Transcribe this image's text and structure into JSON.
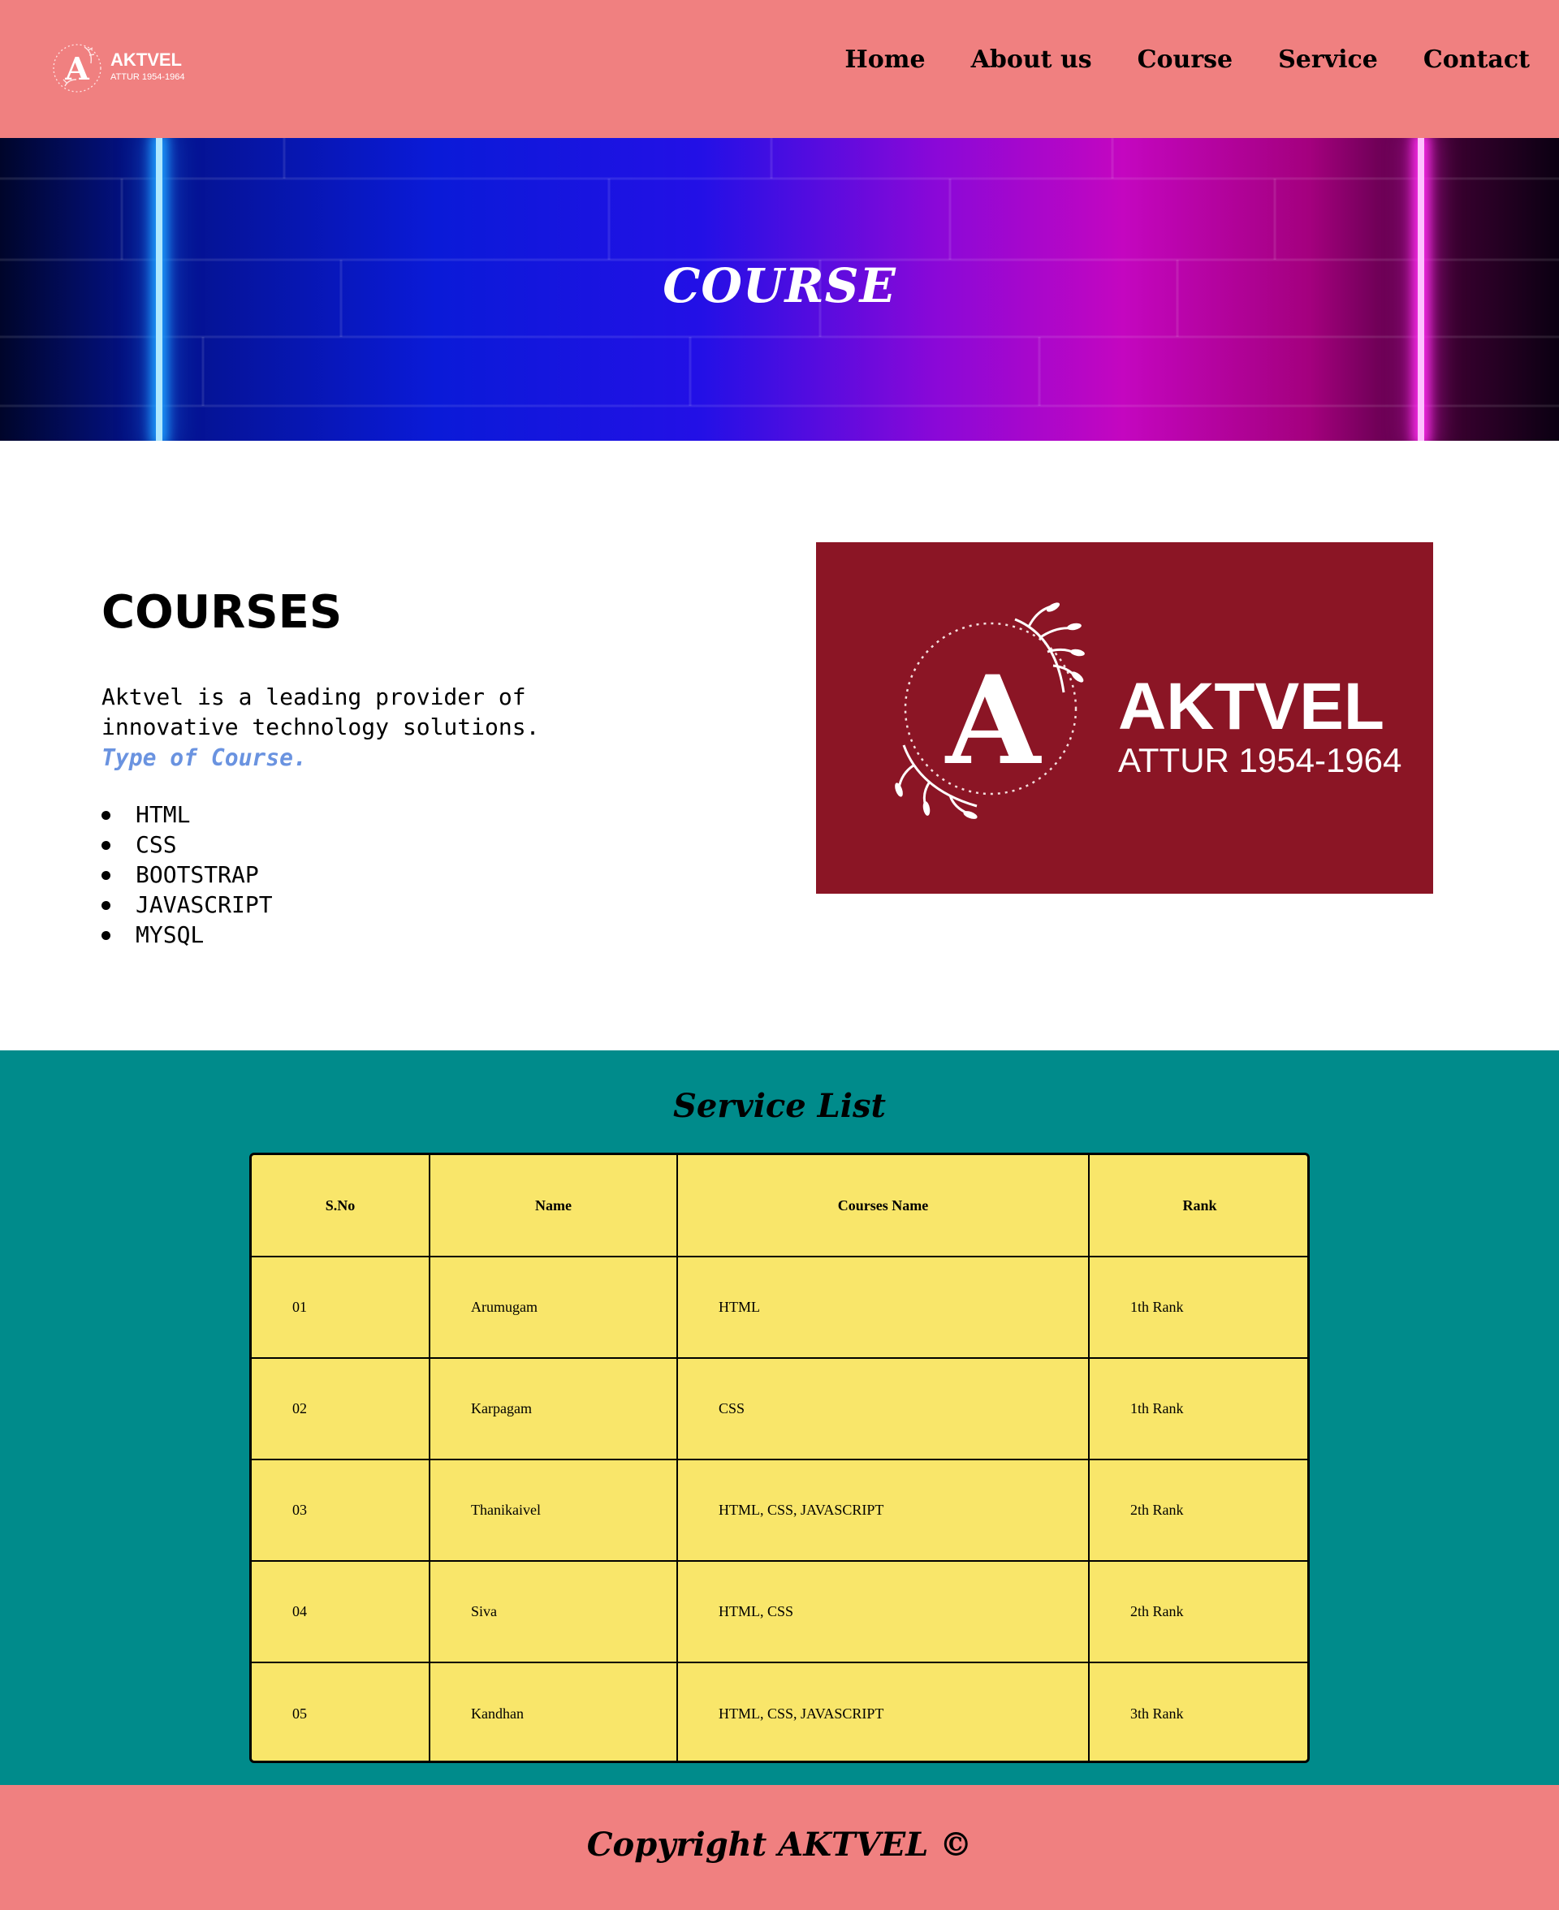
{
  "brand": {
    "name": "AKTVEL",
    "subtitle": "ATTUR 1954-1964",
    "initial": "A"
  },
  "nav": {
    "items": [
      {
        "label": "Home"
      },
      {
        "label": "About us"
      },
      {
        "label": "Course"
      },
      {
        "label": "Service"
      },
      {
        "label": "Contact"
      }
    ]
  },
  "hero": {
    "title": "COURSE"
  },
  "courses": {
    "heading": "COURSES",
    "description": "Aktvel is a leading provider of innovative technology solutions.",
    "type_label": "Type of Course.",
    "items": [
      "HTML",
      "CSS",
      "BOOTSTRAP",
      "JAVASCRIPT",
      "MYSQL"
    ]
  },
  "service": {
    "title": "Service List",
    "columns": [
      "S.No",
      "Name",
      "Courses Name",
      "Rank"
    ],
    "rows": [
      [
        "01",
        "Arumugam",
        "HTML",
        "1th Rank"
      ],
      [
        "02",
        "Karpagam",
        "CSS",
        "1th Rank"
      ],
      [
        "03",
        "Thanikaivel",
        "HTML, CSS, JAVASCRIPT",
        "2th Rank"
      ],
      [
        "04",
        "Siva",
        "HTML, CSS",
        "2th Rank"
      ],
      [
        "05",
        "Kandhan",
        "HTML, CSS, JAVASCRIPT",
        "3th Rank"
      ]
    ]
  },
  "footer": {
    "text": "Copyright AKTVEL ©"
  },
  "colors": {
    "header_bg": "#f08080",
    "service_bg": "#008b8b",
    "table_bg": "#f9e66a",
    "brand_card_bg": "#8b1525",
    "type_label": "#6a93e0"
  }
}
